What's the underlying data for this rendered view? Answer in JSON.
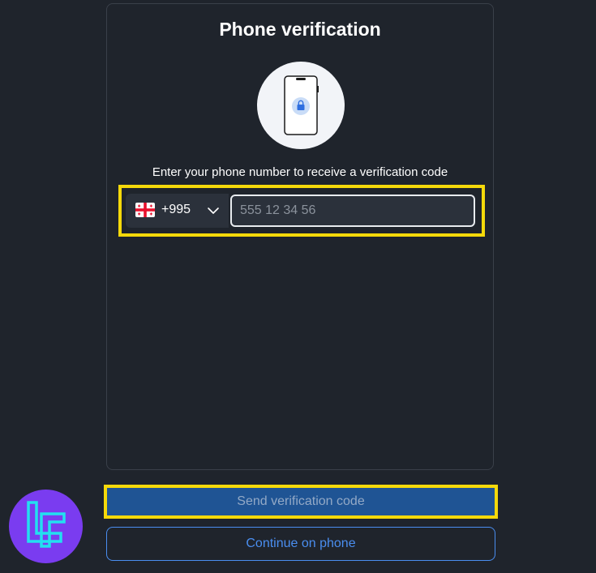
{
  "verification": {
    "title": "Phone verification",
    "subtitle": "Enter your phone number to receive a verification code",
    "country_code": "+995",
    "country_flag": "georgia-flag-icon",
    "phone_placeholder": "555 12 34 56",
    "phone_value": "",
    "send_label": "Send verification code",
    "continue_label": "Continue on phone"
  },
  "colors": {
    "background": "#1f242c",
    "highlight": "#f5d90a",
    "send_button_bg": "#1f5494",
    "continue_accent": "#4a8ef0",
    "logo_bg": "#7a3cf0",
    "logo_fg": "#22e0f0"
  },
  "icons": {
    "illustration": "smartphone-lock-icon",
    "dropdown": "chevron-down-icon",
    "logo": "brand-logo"
  }
}
